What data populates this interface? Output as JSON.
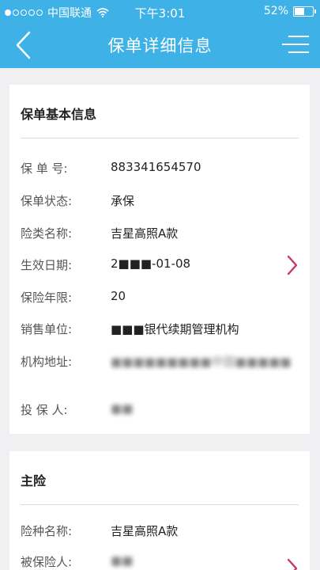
{
  "status_bar": {
    "carrier": "中国联通",
    "time": "下午3:01",
    "battery": "52%",
    "battery_level": 0.52
  },
  "nav": {
    "title": "保单详细信息",
    "back_icon": "chevron-left-icon",
    "menu_icon": "menu-icon"
  },
  "basic_info": {
    "title": "保单基本信息",
    "rows": [
      {
        "label": "保 单 号:",
        "value": "883341654570"
      },
      {
        "label": "保单状态:",
        "value": "承保"
      },
      {
        "label": "险类名称:",
        "value": "吉星高照A款"
      },
      {
        "label": "生效日期:",
        "value": "2■■■-01-08"
      },
      {
        "label": "保险年限:",
        "value": "20"
      },
      {
        "label": "销售单位:",
        "value": "■■■银代续期管理机构"
      },
      {
        "label": "机构地址:",
        "value": "■■■■■■■■■中国■■■■■"
      },
      {
        "label": "投 保 人:",
        "value": "■■"
      }
    ]
  },
  "main_insurance": {
    "title": "主险",
    "rows": [
      {
        "label": "险种名称:",
        "value": "吉星高照A款"
      },
      {
        "label": "被保险人:",
        "value": "■■"
      }
    ]
  },
  "colors": {
    "header_bg": "#3eb1e7",
    "chevron": "#c8356a",
    "page_bg": "#f0f0f2"
  }
}
